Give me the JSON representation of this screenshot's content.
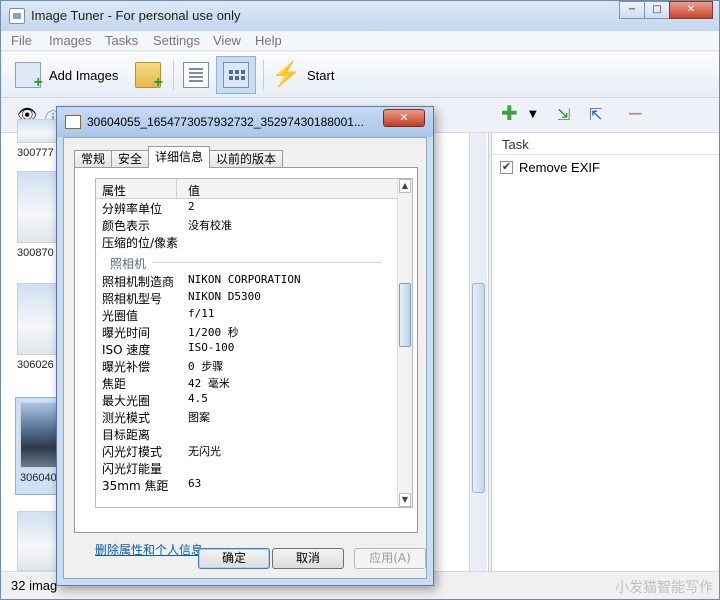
{
  "app": {
    "title": "Image Tuner - For personal use only",
    "window_buttons": [
      "−",
      "□",
      "✕"
    ]
  },
  "menu": [
    "File",
    "Images",
    "Tasks",
    "Settings",
    "View",
    "Help"
  ],
  "toolbar": {
    "add_images": "Add Images",
    "start": "Start"
  },
  "thumbnails": [
    {
      "label": "300777"
    },
    {
      "label": "300870"
    },
    {
      "label": "306026"
    },
    {
      "label": "306040"
    },
    {
      "label": ""
    }
  ],
  "task_panel": {
    "header": "Task",
    "tasks": [
      {
        "label": "Remove EXIF",
        "checked": true
      }
    ]
  },
  "status": {
    "text": "32 imag",
    "watermark": "小发猫智能写作"
  },
  "dialog": {
    "title": "30604055_1654773057932732_35297430188001...",
    "close": "✕",
    "tabs": [
      "常规",
      "安全",
      "详细信息",
      "以前的版本"
    ],
    "active_tab": "详细信息",
    "columns": {
      "property": "属性",
      "value": "值"
    },
    "rows_top": [
      {
        "k": "分辨率单位",
        "v": "2"
      },
      {
        "k": "颜色表示",
        "v": "没有校准"
      },
      {
        "k": "压缩的位/像素",
        "v": ""
      }
    ],
    "group": "照相机",
    "rows_camera": [
      {
        "k": "照相机制造商",
        "v": "NIKON CORPORATION"
      },
      {
        "k": "照相机型号",
        "v": "NIKON D5300"
      },
      {
        "k": "光圈值",
        "v": "f/11"
      },
      {
        "k": "曝光时间",
        "v": "1/200 秒"
      },
      {
        "k": "ISO 速度",
        "v": "ISO-100"
      },
      {
        "k": "曝光补偿",
        "v": "0 步骤"
      },
      {
        "k": "焦距",
        "v": "42 毫米"
      },
      {
        "k": "最大光圈",
        "v": "4.5"
      },
      {
        "k": "测光模式",
        "v": "图案"
      },
      {
        "k": "目标距离",
        "v": ""
      },
      {
        "k": "闪光灯模式",
        "v": "无闪光"
      },
      {
        "k": "闪光灯能量",
        "v": ""
      },
      {
        "k": "35mm 焦距",
        "v": "63"
      }
    ],
    "remove_link": "删除属性和个人信息",
    "buttons": {
      "ok": "确定",
      "cancel": "取消",
      "apply": "应用(A)"
    }
  }
}
